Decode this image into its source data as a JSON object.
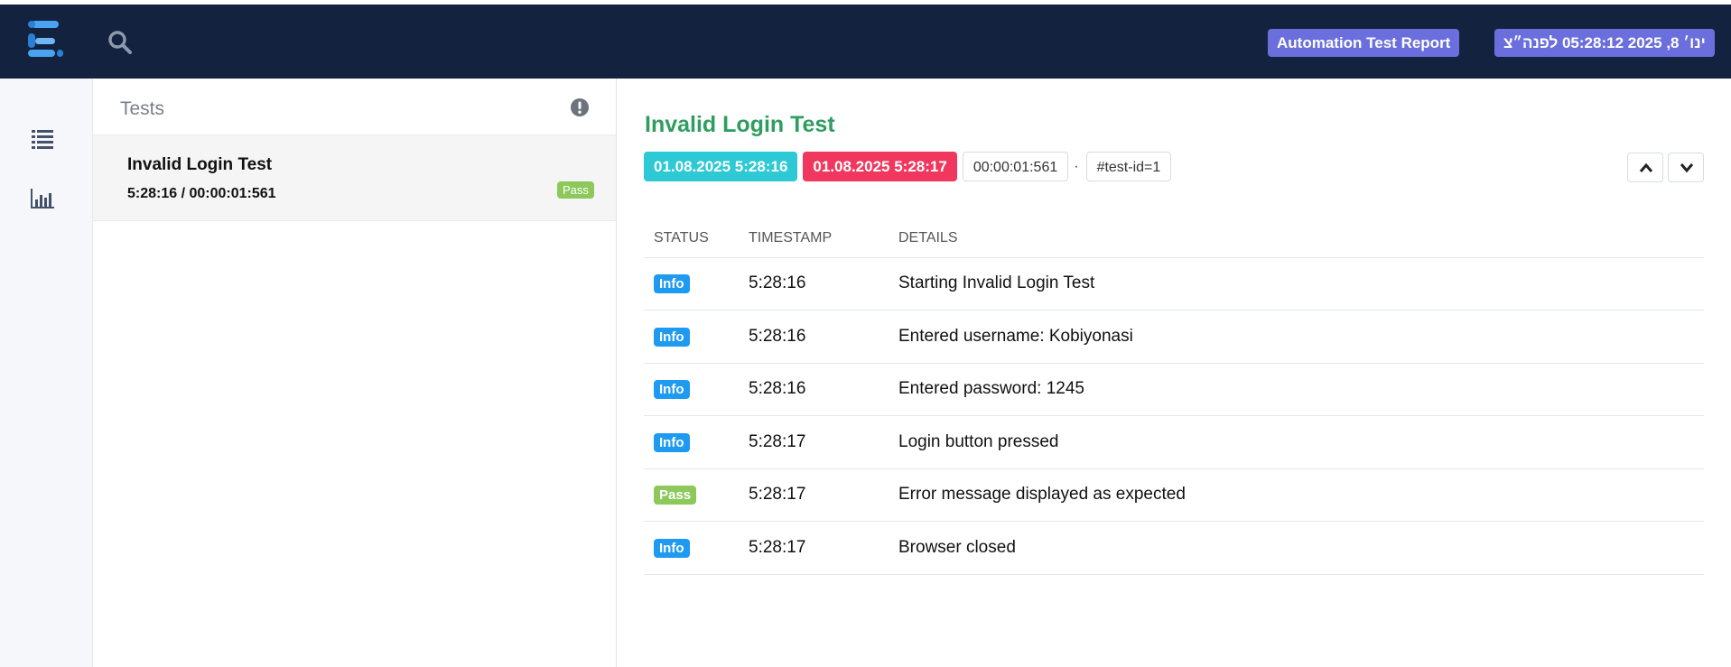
{
  "header": {
    "report_label": "Automation Test Report",
    "date_label": "ינו׳ 8, 2025 05:28:12 לפנה״צ"
  },
  "colors": {
    "navbar": "#13233f",
    "badge": "#6b6fde",
    "title_green": "#2e9d5f",
    "start_tag": "#2dc9d4",
    "end_tag": "#f0375d",
    "pass": "#8dc85b",
    "info": "#1e9af0"
  },
  "sidebar": {
    "items": [
      {
        "icon": "list-icon"
      },
      {
        "icon": "bar-chart-icon"
      }
    ]
  },
  "tests_panel": {
    "title": "Tests",
    "items": [
      {
        "name": "Invalid Login Test",
        "meta": "5:28:16 / 00:00:01:561",
        "status": "Pass"
      }
    ]
  },
  "detail": {
    "title": "Invalid Login Test",
    "start_time": "01.08.2025 5:28:16",
    "end_time": "01.08.2025 5:28:17",
    "duration": "00:00:01:561",
    "separator": "·",
    "test_id": "#test-id=1",
    "columns": [
      "STATUS",
      "TIMESTAMP",
      "DETAILS"
    ],
    "logs": [
      {
        "status": "Info",
        "timestamp": "5:28:16",
        "details": "Starting Invalid Login Test"
      },
      {
        "status": "Info",
        "timestamp": "5:28:16",
        "details": "Entered username: Kobiyonasi"
      },
      {
        "status": "Info",
        "timestamp": "5:28:16",
        "details": "Entered password: 1245"
      },
      {
        "status": "Info",
        "timestamp": "5:28:17",
        "details": "Login button pressed"
      },
      {
        "status": "Pass",
        "timestamp": "5:28:17",
        "details": "Error message displayed as expected"
      },
      {
        "status": "Info",
        "timestamp": "5:28:17",
        "details": "Browser closed"
      }
    ]
  }
}
